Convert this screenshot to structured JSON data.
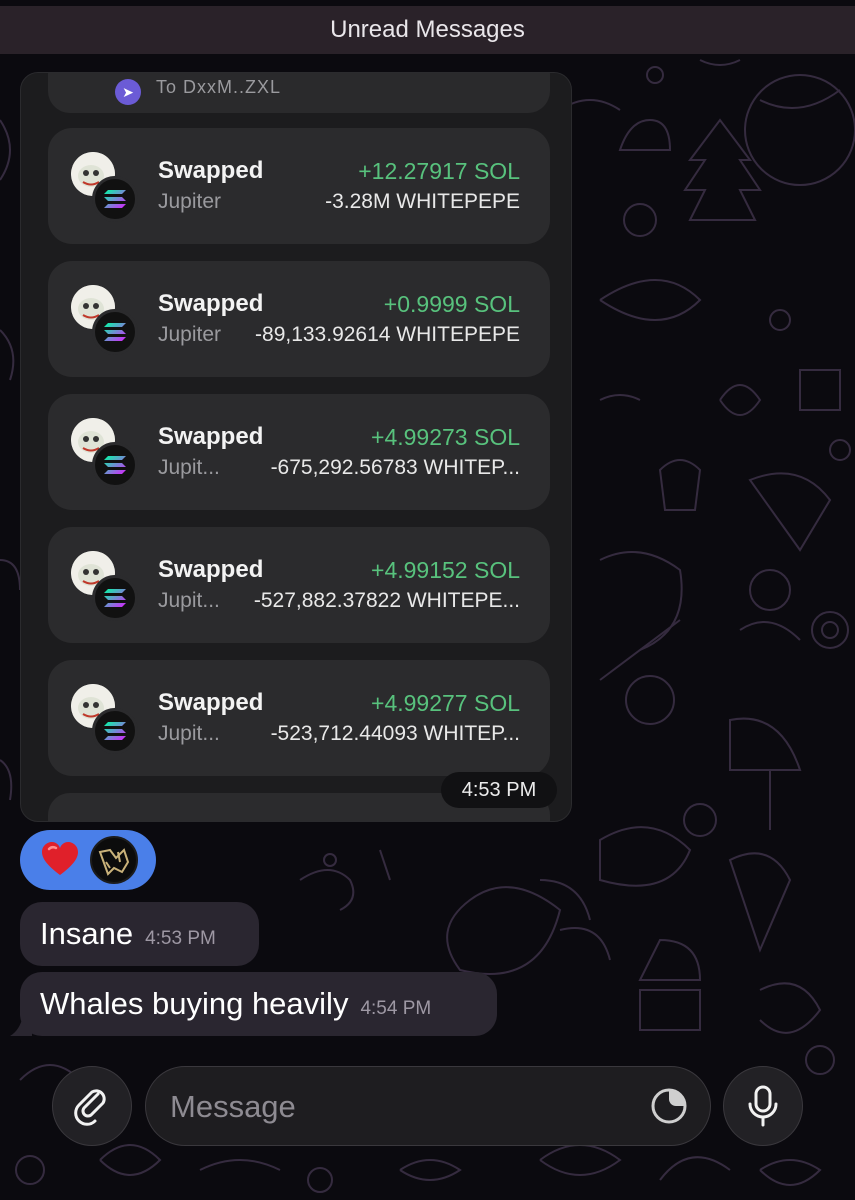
{
  "banner": {
    "label": "Unread Messages"
  },
  "partial_top_text": "To DxxM..ZXL",
  "transactions": [
    {
      "title": "Swapped",
      "source": "Jupiter",
      "gain": "+12.27917 SOL",
      "loss": "-3.28M WHITEPEPE"
    },
    {
      "title": "Swapped",
      "source": "Jupiter",
      "gain": "+0.9999 SOL",
      "loss": "-89,133.92614 WHITEPEPE"
    },
    {
      "title": "Swapped",
      "source": "Jupit...",
      "gain": "+4.99273 SOL",
      "loss": "-675,292.56783 WHITEP..."
    },
    {
      "title": "Swapped",
      "source": "Jupit...",
      "gain": "+4.99152 SOL",
      "loss": "-527,882.37822 WHITEPE..."
    },
    {
      "title": "Swapped",
      "source": "Jupit...",
      "gain": "+4.99277 SOL",
      "loss": "-523,712.44093 WHITEP..."
    }
  ],
  "card_time": "4:53 PM",
  "reaction": {
    "emoji": "heart-icon",
    "color": "#4a7fe9"
  },
  "messages": [
    {
      "text": "Insane",
      "time": "4:53 PM"
    },
    {
      "text": "Whales buying heavily",
      "time": "4:54 PM"
    }
  ],
  "composer": {
    "placeholder": "Message"
  },
  "colors": {
    "gain": "#58c27d",
    "bubble": "#2a2630",
    "accent": "#4a7fe9"
  }
}
